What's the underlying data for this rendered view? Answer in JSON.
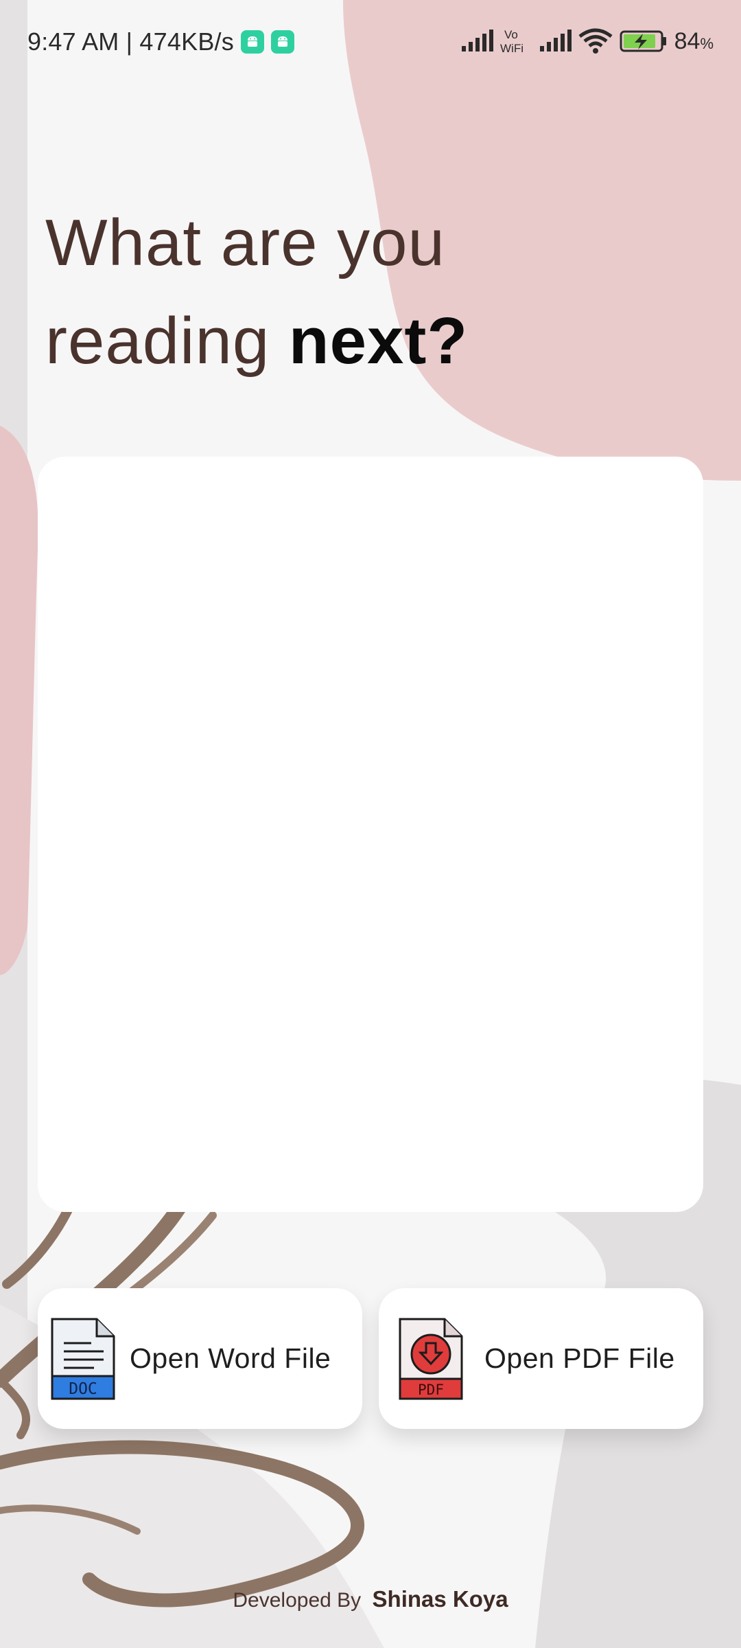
{
  "status_bar": {
    "time_speed": "9:47 AM | 474KB/s",
    "battery_percent": "84",
    "battery_unit": "%",
    "network_label_top": "Vo",
    "network_label_bottom": "WiFi",
    "icons": [
      "android-notification-icon",
      "android-notification-icon",
      "signal-icon",
      "vowifi-icon",
      "signal-icon",
      "wifi-icon",
      "battery-charging-icon"
    ]
  },
  "headline": {
    "line1": "What are you",
    "line2_regular": "reading ",
    "line2_bold": "next?"
  },
  "actions": {
    "word": {
      "label": "Open Word File",
      "icon_text": "DOC",
      "icon": "doc-file-icon"
    },
    "pdf": {
      "label": "Open PDF File",
      "icon_text": "PDF",
      "icon": "pdf-file-icon"
    }
  },
  "footer": {
    "prefix": "Developed By",
    "author": "Shinas Koya"
  },
  "colors": {
    "headline_text": "#4a332d",
    "headline_bold": "#0b0b0b",
    "blob_pink": "#e9c9ca",
    "blob_brown": "#8d7565",
    "card": "#ffffff",
    "doc_blue": "#2f7de1",
    "pdf_red": "#e03c3c",
    "android_badge": "#2fd0a0"
  }
}
